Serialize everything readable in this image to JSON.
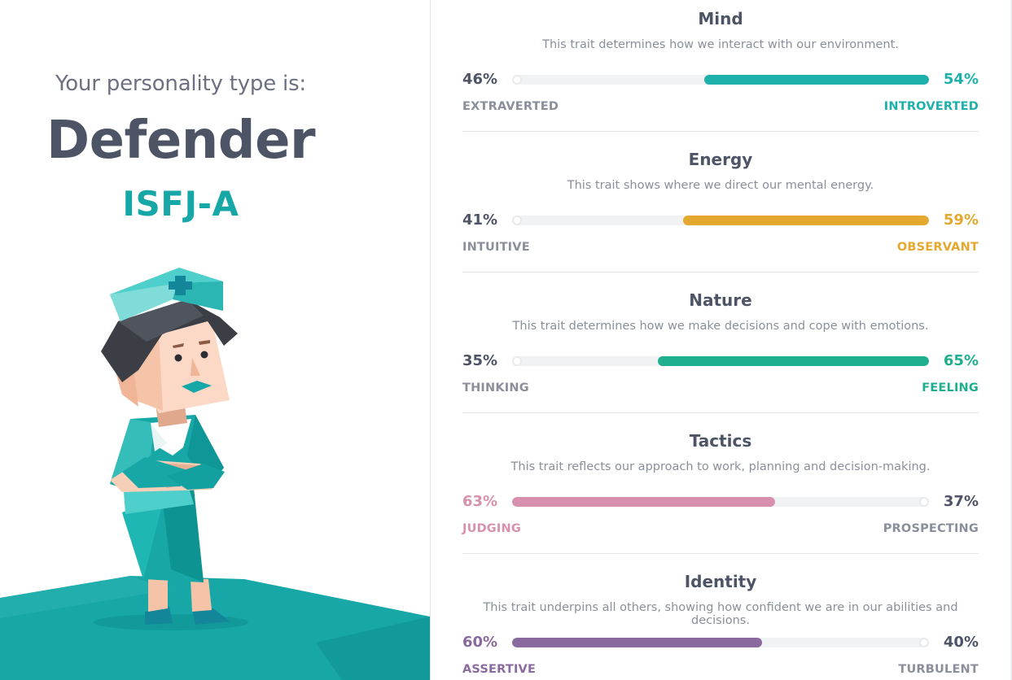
{
  "intro": "Your personality type is:",
  "type_name": "Defender",
  "type_code": "ISFJ-A",
  "colors": {
    "teal": "#17a7a7",
    "mind": "#1eb1ac",
    "energy": "#e5a82e",
    "nature": "#1fae8e",
    "tactics": "#d791ae",
    "identity": "#8a6a9e",
    "text": "#4d5466",
    "muted": "#8a8f9b"
  },
  "traits": [
    {
      "title": "Mind",
      "description": "This trait determines how we interact with our environment.",
      "left_pct": "46%",
      "right_pct": "54%",
      "left_label": "EXTRAVERTED",
      "right_label": "INTROVERTED",
      "dominant": "right",
      "value": 0.54,
      "color": "#1eb1ac"
    },
    {
      "title": "Energy",
      "description": "This trait shows where we direct our mental energy.",
      "left_pct": "41%",
      "right_pct": "59%",
      "left_label": "INTUITIVE",
      "right_label": "OBSERVANT",
      "dominant": "right",
      "value": 0.59,
      "color": "#e5a82e"
    },
    {
      "title": "Nature",
      "description": "This trait determines how we make decisions and cope with emotions.",
      "left_pct": "35%",
      "right_pct": "65%",
      "left_label": "THINKING",
      "right_label": "FEELING",
      "dominant": "right",
      "value": 0.65,
      "color": "#1fae8e"
    },
    {
      "title": "Tactics",
      "description": "This trait reflects our approach to work, planning and decision-making.",
      "left_pct": "63%",
      "right_pct": "37%",
      "left_label": "JUDGING",
      "right_label": "PROSPECTING",
      "dominant": "left",
      "value": 0.63,
      "color": "#d791ae"
    },
    {
      "title": "Identity",
      "description": "This trait underpins all others, showing how confident we are in our abilities and decisions.",
      "left_pct": "60%",
      "right_pct": "40%",
      "left_label": "ASSERTIVE",
      "right_label": "TURBULENT",
      "dominant": "left",
      "value": 0.6,
      "color": "#8a6a9e"
    }
  ]
}
